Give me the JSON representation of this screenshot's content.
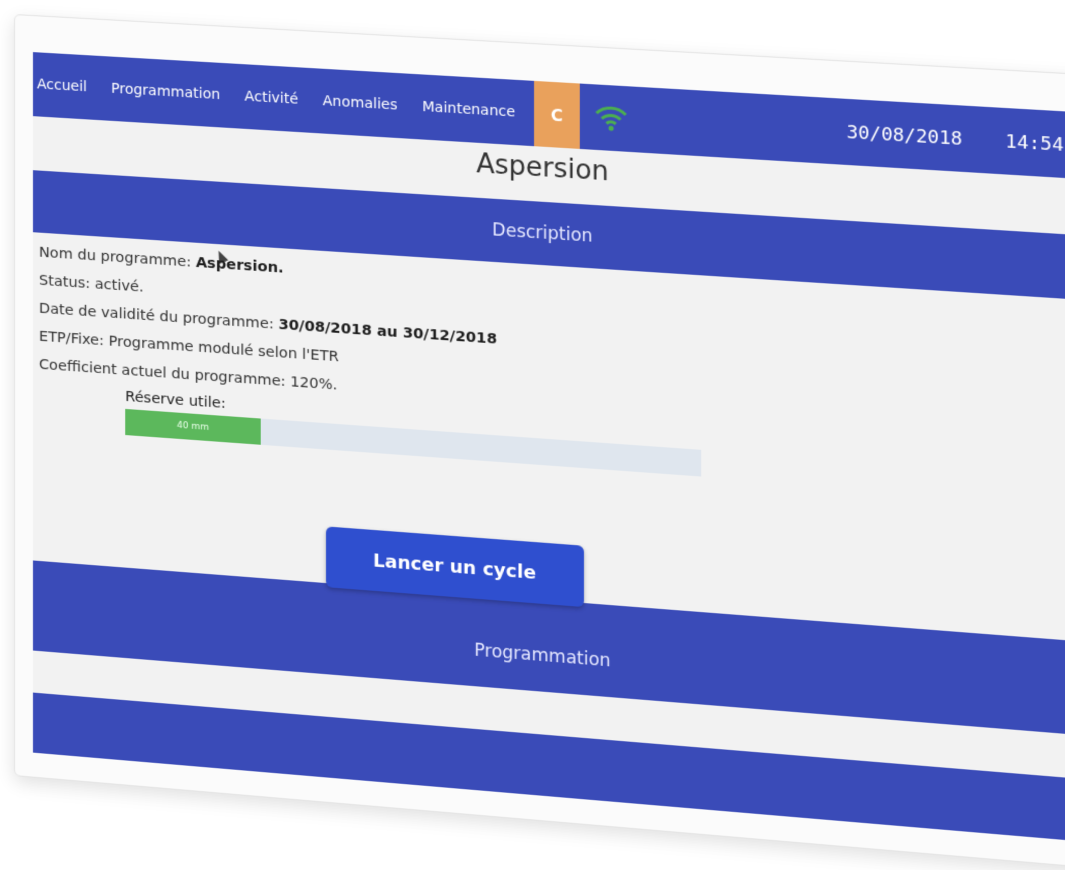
{
  "nav": {
    "items": [
      "Accueil",
      "Programmation",
      "Activité",
      "Anomalies",
      "Maintenance"
    ],
    "c_tile": "C",
    "date": "30/08/2018",
    "time": "14:54"
  },
  "page": {
    "title": "Aspersion",
    "description_band": "Description",
    "programmation_band": "Programmation"
  },
  "details": {
    "name_label": "Nom du programme:",
    "name_value": "Aspersion.",
    "status_label": "Status:",
    "status_value": "activé.",
    "validity_label": "Date de validité du programme:",
    "validity_value": "30/08/2018 au 30/12/2018",
    "etp_label": "ETP/Fixe:",
    "etp_value": "Programme modulé selon l'ETR",
    "coef_label": "Coefficient actuel du programme:",
    "coef_value": "120%.",
    "reserve_label": "Réserve utile:",
    "reserve_value": "40 mm",
    "reserve_fraction": 0.24
  },
  "actions": {
    "launch": "Lancer un cycle"
  },
  "colors": {
    "accent": "#3a4bb8",
    "c_tile": "#e9a15c",
    "wifi": "#4caf50",
    "bar_fill": "#5cb85c"
  },
  "icons": {
    "wifi": "wifi-icon",
    "cursor": "mouse-cursor-icon"
  }
}
